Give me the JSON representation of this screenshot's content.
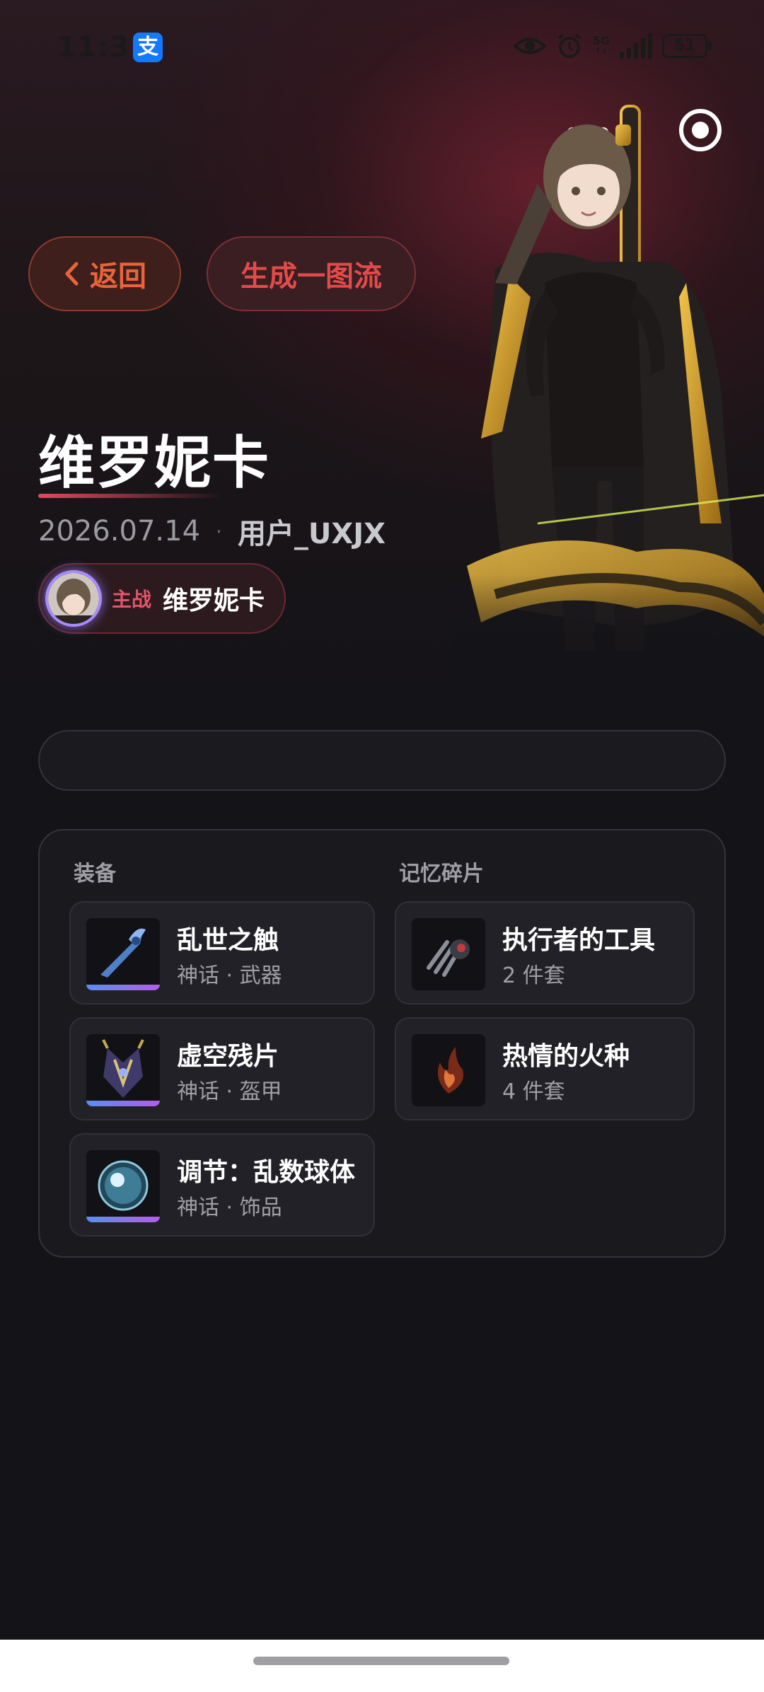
{
  "status_bar": {
    "time": "11:37",
    "app_icon_glyph": "支",
    "network": "5G",
    "battery": "51",
    "icons": [
      "eye-icon",
      "alarm-icon",
      "signal-icon",
      "battery-icon"
    ]
  },
  "header": {
    "back_label": "返回",
    "generate_label": "生成一图流"
  },
  "profile": {
    "title": "维罗妮卡",
    "date": "2026.07.14",
    "separator": "·",
    "user": "用户_UXJX",
    "main_tag": "主战",
    "main_name": "维罗妮卡"
  },
  "gear": {
    "equipment_header": "装备",
    "fragments_header": "记忆碎片",
    "equipment": [
      {
        "name": "乱世之触",
        "sub": "神话 · 武器",
        "icon": "weapon-icon"
      },
      {
        "name": "虚空残片",
        "sub": "神话 · 盔甲",
        "icon": "armor-icon"
      },
      {
        "name": "调节：乱数球体",
        "sub": "神话 · 饰品",
        "icon": "orb-icon"
      }
    ],
    "fragments": [
      {
        "name": "执行者的工具",
        "sub": "2 件套",
        "icon": "claw-icon"
      },
      {
        "name": "热情的火种",
        "sub": "4 件套",
        "icon": "flame-icon"
      }
    ]
  },
  "colors": {
    "accent_red": "#e24b4a",
    "back_orange": "#e8653c",
    "rarity_start": "#5b8df0",
    "rarity_end": "#b25ee6",
    "background": "#141317"
  }
}
